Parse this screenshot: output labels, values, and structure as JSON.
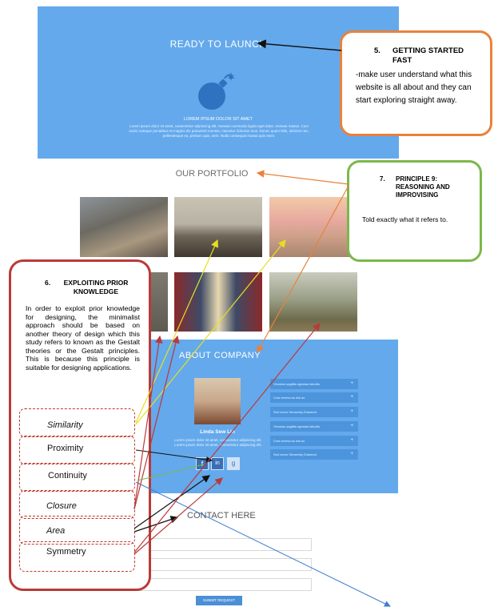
{
  "launch": {
    "title": "READY TO LAUNCH",
    "subtitle": "LOREM IPSUM DOLOR SIT AMET",
    "body": "Lorem ipsum dolor sit amet, consectetur adipiscing elit. Aenean commodo ligula eget dolor. Aenean massa. Cum sociis natoque penatibus et magnis dis parturient montes, nascetur ridiculus mus. Donec quam felis, ultricies nec, pellentesque eu, pretium quis, sem. Nulla consequat massa quis enim."
  },
  "portfolio": {
    "title": "OUR PORTFOLIO"
  },
  "about": {
    "title": "ABOUT COMPANY",
    "person_name": "Linda Sew Lin",
    "person_bio": "Lorem ipsum dolor sit amet, consectetur adipiscing elit. Lorem ipsum dolor sit amet, consectetur adipiscing elit.",
    "accordion": [
      "Vivamus sagittis egestas lobortis",
      "Cras viverra ac nisi ac",
      "Sed lorem Sensenby Euismod",
      "Vivamus sagittis egestas lobortis",
      "Cras viverra ac nisi ac",
      "Sed lorem Sensenby Euismod"
    ],
    "social": [
      "f",
      "in",
      "g"
    ]
  },
  "contact": {
    "title": "CONTACT HERE",
    "submit_label": "SUBMIT REQUEST"
  },
  "callouts": {
    "getting_started": {
      "number": "5.",
      "title": "GETTING STARTED FAST",
      "body": "-make user understand what this website is all about and they can start exploring straight away."
    },
    "principle9": {
      "number": "7.",
      "title": "PRINCIPLE 9: REASONING AND IMPROVISING",
      "body": "Told exactly what it refers to."
    },
    "prior_knowledge": {
      "number": "6.",
      "title": "EXPLOITING PRIOR KNOWLEDGE",
      "body": "In order to exploit prior knowledge for designing, the minimalist approach should be based on another theory of design which this study refers to known as the Gestalt theories or the Gestalt principles. This is because this principle is suitable for designing applications.",
      "principles": [
        "Similarity",
        "Proximity",
        "Continuity",
        "Closure",
        "Area",
        "Symmetry"
      ]
    }
  },
  "colors": {
    "panel_blue": "#64a9ec",
    "orange": "#e8823a",
    "green": "#7bb84a",
    "red": "#b93a3a",
    "yellow": "#f0f04a"
  }
}
